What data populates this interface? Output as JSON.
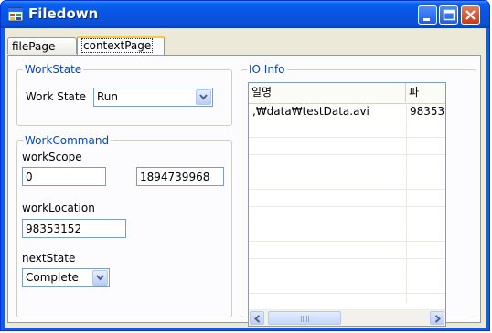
{
  "window": {
    "title": "Filedown"
  },
  "tabs": {
    "file_page": "filePage",
    "context_page": "contextPage"
  },
  "work_state": {
    "legend": "WorkState",
    "label": "Work State",
    "value": "Run"
  },
  "work_command": {
    "legend": "WorkCommand",
    "scope_label": "workScope",
    "scope_start": "0",
    "scope_end": "1894739968",
    "location_label": "workLocation",
    "location_value": "98353152",
    "next_state_label": "nextState",
    "next_state_value": "Complete"
  },
  "io_info": {
    "legend": "IO Info",
    "columns": [
      "일명",
      "파"
    ],
    "rows": [
      [
        ",₩data₩testData.avi",
        "98353"
      ]
    ],
    "scroll_position": 0
  },
  "colors": {
    "titlebar": "#0a5fe6",
    "legend_text": "#0046d5",
    "client_bg": "#ece9d8",
    "tab_highlight": "#ffc83c"
  },
  "icons": {
    "app": "app-window-icon",
    "minimize": "minimize-icon",
    "maximize": "maximize-icon",
    "close": "close-icon"
  }
}
